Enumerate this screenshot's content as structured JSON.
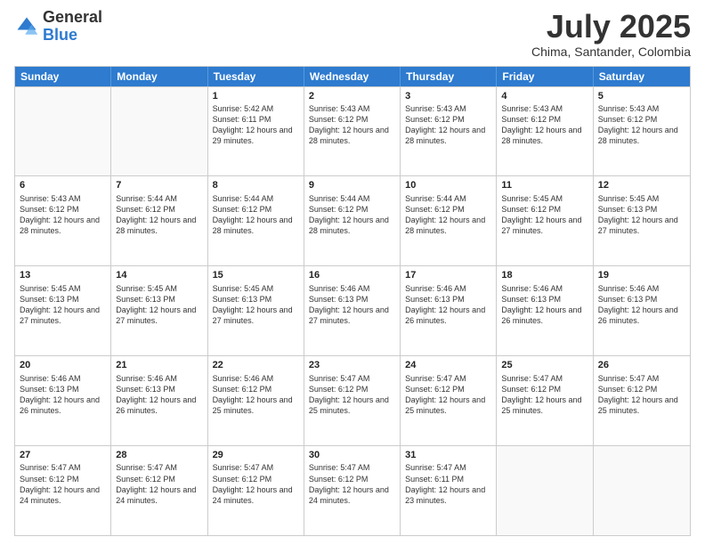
{
  "logo": {
    "general": "General",
    "blue": "Blue"
  },
  "header": {
    "month": "July 2025",
    "location": "Chima, Santander, Colombia"
  },
  "days_of_week": [
    "Sunday",
    "Monday",
    "Tuesday",
    "Wednesday",
    "Thursday",
    "Friday",
    "Saturday"
  ],
  "weeks": [
    [
      {
        "day": "",
        "empty": true
      },
      {
        "day": "",
        "empty": true
      },
      {
        "day": "1",
        "sunrise": "5:42 AM",
        "sunset": "6:11 PM",
        "daylight": "12 hours and 29 minutes."
      },
      {
        "day": "2",
        "sunrise": "5:43 AM",
        "sunset": "6:12 PM",
        "daylight": "12 hours and 28 minutes."
      },
      {
        "day": "3",
        "sunrise": "5:43 AM",
        "sunset": "6:12 PM",
        "daylight": "12 hours and 28 minutes."
      },
      {
        "day": "4",
        "sunrise": "5:43 AM",
        "sunset": "6:12 PM",
        "daylight": "12 hours and 28 minutes."
      },
      {
        "day": "5",
        "sunrise": "5:43 AM",
        "sunset": "6:12 PM",
        "daylight": "12 hours and 28 minutes."
      }
    ],
    [
      {
        "day": "6",
        "sunrise": "5:43 AM",
        "sunset": "6:12 PM",
        "daylight": "12 hours and 28 minutes."
      },
      {
        "day": "7",
        "sunrise": "5:44 AM",
        "sunset": "6:12 PM",
        "daylight": "12 hours and 28 minutes."
      },
      {
        "day": "8",
        "sunrise": "5:44 AM",
        "sunset": "6:12 PM",
        "daylight": "12 hours and 28 minutes."
      },
      {
        "day": "9",
        "sunrise": "5:44 AM",
        "sunset": "6:12 PM",
        "daylight": "12 hours and 28 minutes."
      },
      {
        "day": "10",
        "sunrise": "5:44 AM",
        "sunset": "6:12 PM",
        "daylight": "12 hours and 28 minutes."
      },
      {
        "day": "11",
        "sunrise": "5:45 AM",
        "sunset": "6:12 PM",
        "daylight": "12 hours and 27 minutes."
      },
      {
        "day": "12",
        "sunrise": "5:45 AM",
        "sunset": "6:13 PM",
        "daylight": "12 hours and 27 minutes."
      }
    ],
    [
      {
        "day": "13",
        "sunrise": "5:45 AM",
        "sunset": "6:13 PM",
        "daylight": "12 hours and 27 minutes."
      },
      {
        "day": "14",
        "sunrise": "5:45 AM",
        "sunset": "6:13 PM",
        "daylight": "12 hours and 27 minutes."
      },
      {
        "day": "15",
        "sunrise": "5:45 AM",
        "sunset": "6:13 PM",
        "daylight": "12 hours and 27 minutes."
      },
      {
        "day": "16",
        "sunrise": "5:46 AM",
        "sunset": "6:13 PM",
        "daylight": "12 hours and 27 minutes."
      },
      {
        "day": "17",
        "sunrise": "5:46 AM",
        "sunset": "6:13 PM",
        "daylight": "12 hours and 26 minutes."
      },
      {
        "day": "18",
        "sunrise": "5:46 AM",
        "sunset": "6:13 PM",
        "daylight": "12 hours and 26 minutes."
      },
      {
        "day": "19",
        "sunrise": "5:46 AM",
        "sunset": "6:13 PM",
        "daylight": "12 hours and 26 minutes."
      }
    ],
    [
      {
        "day": "20",
        "sunrise": "5:46 AM",
        "sunset": "6:13 PM",
        "daylight": "12 hours and 26 minutes."
      },
      {
        "day": "21",
        "sunrise": "5:46 AM",
        "sunset": "6:13 PM",
        "daylight": "12 hours and 26 minutes."
      },
      {
        "day": "22",
        "sunrise": "5:46 AM",
        "sunset": "6:12 PM",
        "daylight": "12 hours and 25 minutes."
      },
      {
        "day": "23",
        "sunrise": "5:47 AM",
        "sunset": "6:12 PM",
        "daylight": "12 hours and 25 minutes."
      },
      {
        "day": "24",
        "sunrise": "5:47 AM",
        "sunset": "6:12 PM",
        "daylight": "12 hours and 25 minutes."
      },
      {
        "day": "25",
        "sunrise": "5:47 AM",
        "sunset": "6:12 PM",
        "daylight": "12 hours and 25 minutes."
      },
      {
        "day": "26",
        "sunrise": "5:47 AM",
        "sunset": "6:12 PM",
        "daylight": "12 hours and 25 minutes."
      }
    ],
    [
      {
        "day": "27",
        "sunrise": "5:47 AM",
        "sunset": "6:12 PM",
        "daylight": "12 hours and 24 minutes."
      },
      {
        "day": "28",
        "sunrise": "5:47 AM",
        "sunset": "6:12 PM",
        "daylight": "12 hours and 24 minutes."
      },
      {
        "day": "29",
        "sunrise": "5:47 AM",
        "sunset": "6:12 PM",
        "daylight": "12 hours and 24 minutes."
      },
      {
        "day": "30",
        "sunrise": "5:47 AM",
        "sunset": "6:12 PM",
        "daylight": "12 hours and 24 minutes."
      },
      {
        "day": "31",
        "sunrise": "5:47 AM",
        "sunset": "6:11 PM",
        "daylight": "12 hours and 23 minutes."
      },
      {
        "day": "",
        "empty": true
      },
      {
        "day": "",
        "empty": true
      }
    ]
  ]
}
